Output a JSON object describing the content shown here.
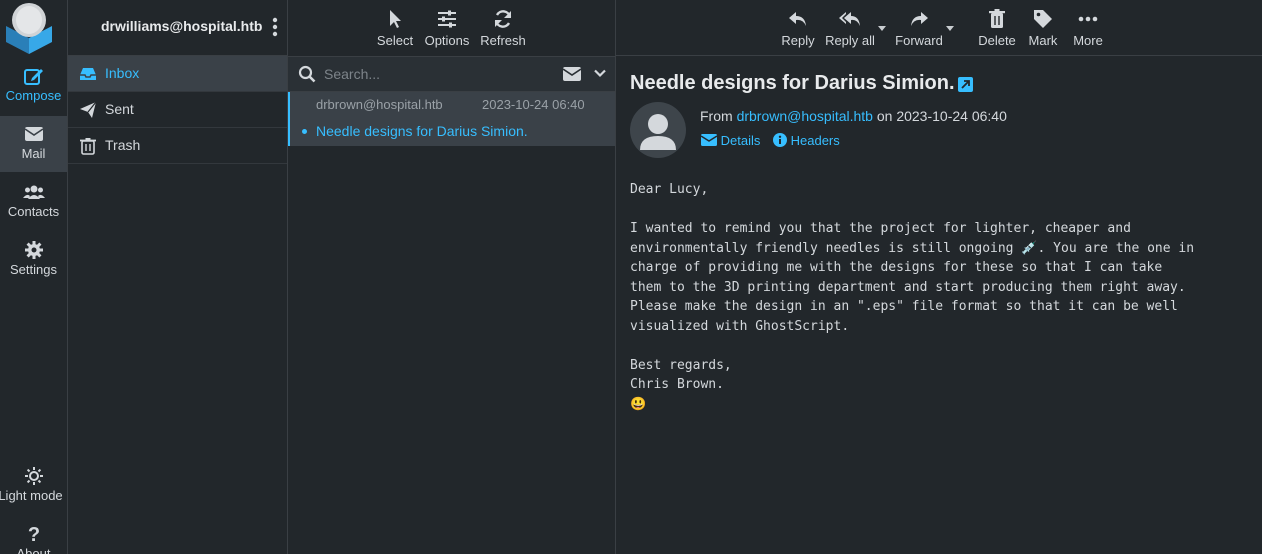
{
  "rail": {
    "compose": "Compose",
    "mail": "Mail",
    "contacts": "Contacts",
    "settings": "Settings",
    "light_mode": "Light mode",
    "about": "About"
  },
  "account": {
    "name": "drwilliams@hospital.htb"
  },
  "folders": [
    {
      "label": "Inbox",
      "icon": "inbox-icon",
      "active": true
    },
    {
      "label": "Sent",
      "icon": "paper-plane-icon"
    },
    {
      "label": "Trash",
      "icon": "trash-icon"
    }
  ],
  "list_toolbar": {
    "select": "Select",
    "options": "Options",
    "refresh": "Refresh"
  },
  "search": {
    "placeholder": "Search..."
  },
  "messages": [
    {
      "from": "drbrown@hospital.htb",
      "date": "2023-10-24 06:40",
      "subject": "Needle designs for Darius Simion.",
      "unread": true
    }
  ],
  "pane_toolbar": {
    "reply": "Reply",
    "reply_all": "Reply all",
    "forward": "Forward",
    "delete": "Delete",
    "mark": "Mark",
    "more": "More"
  },
  "email": {
    "subject": "Needle designs for Darius Simion.",
    "from_prefix": "From",
    "from": "drbrown@hospital.htb",
    "on_prefix": "on",
    "date": "2023-10-24 06:40",
    "details": "Details",
    "headers": "Headers",
    "body": "Dear Lucy,\n\nI wanted to remind you that the project for lighter, cheaper and\nenvironmentally friendly needles is still ongoing 💉. You are the one in\ncharge of providing me with the designs for these so that I can take\nthem to the 3D printing department and start producing them right away.\nPlease make the design in an \".eps\" file format so that it can be well\nvisualized with GhostScript.\n\nBest regards,\nChris Brown.\n😃"
  },
  "colors": {
    "accent": "#37beff",
    "bg": "#22272b",
    "selected": "#3a4148"
  }
}
